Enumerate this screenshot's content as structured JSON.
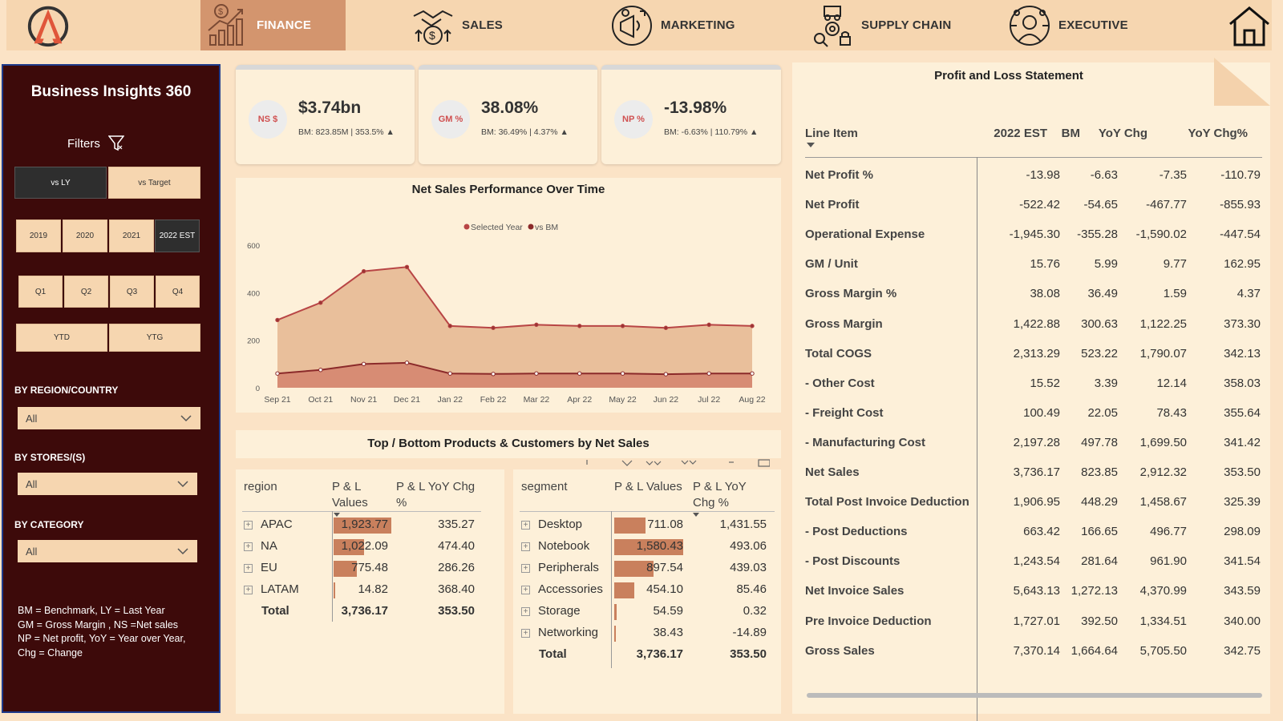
{
  "nav": {
    "tabs": [
      {
        "label": "FINANCE",
        "icon": "finance-icon",
        "active": true
      },
      {
        "label": "SALES",
        "icon": "sales-icon",
        "active": false
      },
      {
        "label": "MARKETING",
        "icon": "marketing-icon",
        "active": false
      },
      {
        "label": "SUPPLY CHAIN",
        "icon": "supply-chain-icon",
        "active": false
      },
      {
        "label": "EXECUTIVE",
        "icon": "executive-icon",
        "active": false
      }
    ],
    "home_icon": "home-icon",
    "accent": "#d3956e"
  },
  "sidebar": {
    "title": "Business Insights 360",
    "filters_label": "Filters",
    "compare": [
      "vs LY",
      "vs Target"
    ],
    "compare_selected": "vs LY",
    "years": [
      "2019",
      "2020",
      "2021",
      "2022 EST"
    ],
    "year_selected": "2022 EST",
    "quarters": [
      "Q1",
      "Q2",
      "Q3",
      "Q4"
    ],
    "periods": [
      "YTD",
      "YTG"
    ],
    "region_label": "BY REGION/COUNTRY",
    "region_value": "All",
    "stores_label": "BY STORES/(S)",
    "stores_value": "All",
    "category_label": "BY CATEGORY",
    "category_value": "All",
    "legend": [
      "BM = Benchmark, LY = Last Year",
      "GM = Gross Margin , NS =Net sales",
      "NP = Net profit,  YoY = Year over Year,",
      "Chg = Change"
    ],
    "bg_color": "#3d0a0a"
  },
  "kpis": [
    {
      "badge": "NS $",
      "value": "$3.74bn",
      "sub": "BM: 823.85M | 353.5% ▲"
    },
    {
      "badge": "GM %",
      "value": "38.08%",
      "sub": "BM: 36.49% | 4.37% ▲"
    },
    {
      "badge": "NP %",
      "value": "-13.98%",
      "sub": "BM: -6.63% | 110.79% ▲"
    }
  ],
  "chart_data": {
    "type": "area",
    "title": "Net Sales Performance Over Time",
    "categories": [
      "Sep 21",
      "Oct 21",
      "Nov 21",
      "Dec 21",
      "Jan 22",
      "Feb 22",
      "Mar 22",
      "Apr 22",
      "May 22",
      "Jun 22",
      "Jul 22",
      "Aug 22"
    ],
    "series": [
      {
        "name": "Selected Year",
        "values": [
          285,
          358,
          490,
          508,
          260,
          252,
          265,
          260,
          260,
          252,
          265,
          260
        ],
        "color": "#b84545"
      },
      {
        "name": "vs BM",
        "values": [
          60,
          75,
          100,
          105,
          60,
          58,
          60,
          60,
          60,
          57,
          60,
          60
        ],
        "color": "#8b2a2a"
      }
    ],
    "ylim": [
      0,
      600
    ],
    "yticks": [
      "0",
      "200",
      "400",
      "600"
    ],
    "legend_position": "top-center",
    "grid": false
  },
  "topbottom": {
    "title": "Top / Bottom Products & Customers by Net Sales",
    "region_table": {
      "headers": [
        "region",
        "P & L Values",
        "P & L YoY Chg %"
      ],
      "rows": [
        {
          "name": "APAC",
          "value": "1,923.77",
          "value_num": 1923.77,
          "yoy": "335.27"
        },
        {
          "name": "NA",
          "value": "1,022.09",
          "value_num": 1022.09,
          "yoy": "474.40"
        },
        {
          "name": "EU",
          "value": "775.48",
          "value_num": 775.48,
          "yoy": "286.26"
        },
        {
          "name": "LATAM",
          "value": "14.82",
          "value_num": 14.82,
          "yoy": "368.40"
        }
      ],
      "total": {
        "label": "Total",
        "value": "3,736.17",
        "yoy": "353.50"
      }
    },
    "segment_table": {
      "headers": [
        "segment",
        "P & L Values",
        "P & L YoY Chg %"
      ],
      "rows": [
        {
          "name": "Desktop",
          "value": "711.08",
          "value_num": 711.08,
          "yoy": "1,431.55"
        },
        {
          "name": "Notebook",
          "value": "1,580.43",
          "value_num": 1580.43,
          "yoy": "493.06"
        },
        {
          "name": "Peripherals",
          "value": "897.54",
          "value_num": 897.54,
          "yoy": "439.03"
        },
        {
          "name": "Accessories",
          "value": "454.10",
          "value_num": 454.1,
          "yoy": "85.46"
        },
        {
          "name": "Storage",
          "value": "54.59",
          "value_num": 54.59,
          "yoy": "0.32"
        },
        {
          "name": "Networking",
          "value": "38.43",
          "value_num": 38.43,
          "yoy": "-14.89"
        }
      ],
      "total": {
        "label": "Total",
        "value": "3,736.17",
        "yoy": "353.50"
      }
    }
  },
  "pl": {
    "title": "Profit and  Loss Statement",
    "headers": [
      "Line Item",
      "2022 EST",
      "BM",
      "YoY Chg",
      "YoY Chg%"
    ],
    "rows": [
      [
        "Net Profit %",
        "-13.98",
        "-6.63",
        "-7.35",
        "-110.79"
      ],
      [
        "Net Profit",
        "-522.42",
        "-54.65",
        "-467.77",
        "-855.93"
      ],
      [
        "Operational Expense",
        "-1,945.30",
        "-355.28",
        "-1,590.02",
        "-447.54"
      ],
      [
        "GM / Unit",
        "15.76",
        "5.99",
        "9.77",
        "162.95"
      ],
      [
        "Gross Margin %",
        "38.08",
        "36.49",
        "1.59",
        "4.37"
      ],
      [
        "Gross Margin",
        "1,422.88",
        "300.63",
        "1,122.25",
        "373.30"
      ],
      [
        "Total COGS",
        "2,313.29",
        "523.22",
        "1,790.07",
        "342.13"
      ],
      [
        "- Other Cost",
        "15.52",
        "3.39",
        "12.14",
        "358.03"
      ],
      [
        "- Freight Cost",
        "100.49",
        "22.05",
        "78.43",
        "355.64"
      ],
      [
        "- Manufacturing Cost",
        "2,197.28",
        "497.78",
        "1,699.50",
        "341.42"
      ],
      [
        "Net Sales",
        "3,736.17",
        "823.85",
        "2,912.32",
        "353.50"
      ],
      [
        "Total Post Invoice Deduction",
        "1,906.95",
        "448.29",
        "1,458.67",
        "325.39"
      ],
      [
        "- Post Deductions",
        "663.42",
        "166.65",
        "496.77",
        "298.09"
      ],
      [
        "- Post Discounts",
        "1,243.54",
        "281.64",
        "961.90",
        "341.54"
      ],
      [
        "Net Invoice Sales",
        "5,643.13",
        "1,272.13",
        "4,370.99",
        "343.59"
      ],
      [
        "Pre Invoice Deduction",
        "1,727.01",
        "392.50",
        "1,334.51",
        "340.00"
      ],
      [
        "Gross Sales",
        "7,370.14",
        "1,664.64",
        "5,705.50",
        "342.75"
      ]
    ]
  }
}
